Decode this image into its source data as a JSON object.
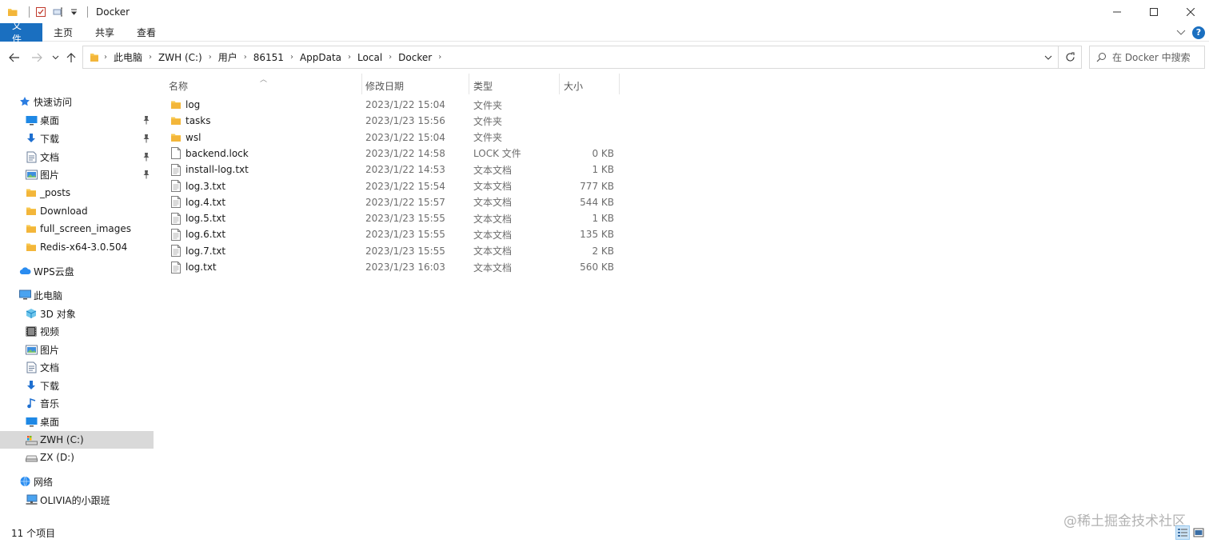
{
  "window": {
    "title": "Docker"
  },
  "ribbon": {
    "tabs": [
      "文件",
      "主页",
      "共享",
      "查看"
    ]
  },
  "address": {
    "crumbs": [
      "此电脑",
      "ZWH (C:)",
      "用户",
      "86151",
      "AppData",
      "Local",
      "Docker"
    ]
  },
  "search": {
    "placeholder": "在 Docker 中搜索"
  },
  "sidebar": {
    "items": [
      {
        "label": "快速访问",
        "icon": "star-icon",
        "level": 0,
        "pinned": false
      },
      {
        "label": "桌面",
        "icon": "desktop-icon",
        "level": 1,
        "pinned": true
      },
      {
        "label": "下载",
        "icon": "download-icon",
        "level": 1,
        "pinned": true
      },
      {
        "label": "文档",
        "icon": "document-icon",
        "level": 1,
        "pinned": true
      },
      {
        "label": "图片",
        "icon": "pictures-icon",
        "level": 1,
        "pinned": true
      },
      {
        "label": "_posts",
        "icon": "folder-icon",
        "level": 1,
        "pinned": false
      },
      {
        "label": "Download",
        "icon": "folder-icon",
        "level": 1,
        "pinned": false
      },
      {
        "label": "full_screen_images",
        "icon": "folder-icon",
        "level": 1,
        "pinned": false
      },
      {
        "label": "Redis-x64-3.0.504",
        "icon": "folder-icon",
        "level": 1,
        "pinned": false
      },
      {
        "label": "WPS云盘",
        "icon": "cloud-icon",
        "level": 0,
        "pinned": false
      },
      {
        "label": "此电脑",
        "icon": "computer-icon",
        "level": 0,
        "pinned": false
      },
      {
        "label": "3D 对象",
        "icon": "3d-objects-icon",
        "level": 1,
        "pinned": false
      },
      {
        "label": "视频",
        "icon": "video-icon",
        "level": 1,
        "pinned": false
      },
      {
        "label": "图片",
        "icon": "pictures-icon",
        "level": 1,
        "pinned": false
      },
      {
        "label": "文档",
        "icon": "document-icon",
        "level": 1,
        "pinned": false
      },
      {
        "label": "下载",
        "icon": "download-icon",
        "level": 1,
        "pinned": false
      },
      {
        "label": "音乐",
        "icon": "music-icon",
        "level": 1,
        "pinned": false
      },
      {
        "label": "桌面",
        "icon": "desktop-icon",
        "level": 1,
        "pinned": false
      },
      {
        "label": "ZWH (C:)",
        "icon": "system-drive-icon",
        "level": 1,
        "pinned": false,
        "selected": true
      },
      {
        "label": "ZX (D:)",
        "icon": "drive-icon",
        "level": 1,
        "pinned": false
      },
      {
        "label": "网络",
        "icon": "network-icon",
        "level": 0,
        "pinned": false
      },
      {
        "label": "OLIVIA的小跟班",
        "icon": "network-computer-icon",
        "level": 1,
        "pinned": false
      }
    ]
  },
  "columns": {
    "name": "名称",
    "date": "修改日期",
    "type": "类型",
    "size": "大小"
  },
  "files": [
    {
      "name": "log",
      "date": "2023/1/22 15:04",
      "type": "文件夹",
      "size": "",
      "kind": "folder"
    },
    {
      "name": "tasks",
      "date": "2023/1/23 15:56",
      "type": "文件夹",
      "size": "",
      "kind": "folder"
    },
    {
      "name": "wsl",
      "date": "2023/1/22 15:04",
      "type": "文件夹",
      "size": "",
      "kind": "folder"
    },
    {
      "name": "backend.lock",
      "date": "2023/1/22 14:58",
      "type": "LOCK 文件",
      "size": "0 KB",
      "kind": "file"
    },
    {
      "name": "install-log.txt",
      "date": "2023/1/22 14:53",
      "type": "文本文档",
      "size": "1 KB",
      "kind": "file"
    },
    {
      "name": "log.3.txt",
      "date": "2023/1/22 15:54",
      "type": "文本文档",
      "size": "777 KB",
      "kind": "file"
    },
    {
      "name": "log.4.txt",
      "date": "2023/1/22 15:57",
      "type": "文本文档",
      "size": "544 KB",
      "kind": "file"
    },
    {
      "name": "log.5.txt",
      "date": "2023/1/23 15:55",
      "type": "文本文档",
      "size": "1 KB",
      "kind": "file"
    },
    {
      "name": "log.6.txt",
      "date": "2023/1/23 15:55",
      "type": "文本文档",
      "size": "135 KB",
      "kind": "file"
    },
    {
      "name": "log.7.txt",
      "date": "2023/1/23 15:55",
      "type": "文本文档",
      "size": "2 KB",
      "kind": "file"
    },
    {
      "name": "log.txt",
      "date": "2023/1/23 16:03",
      "type": "文本文档",
      "size": "560 KB",
      "kind": "file"
    }
  ],
  "status": {
    "item_count": "11 个项目"
  },
  "watermark": "@稀土掘金技术社区",
  "colors": {
    "accent": "#1a6fc0",
    "folder": "#f8c851",
    "selected_bg": "#d9d9d9"
  }
}
